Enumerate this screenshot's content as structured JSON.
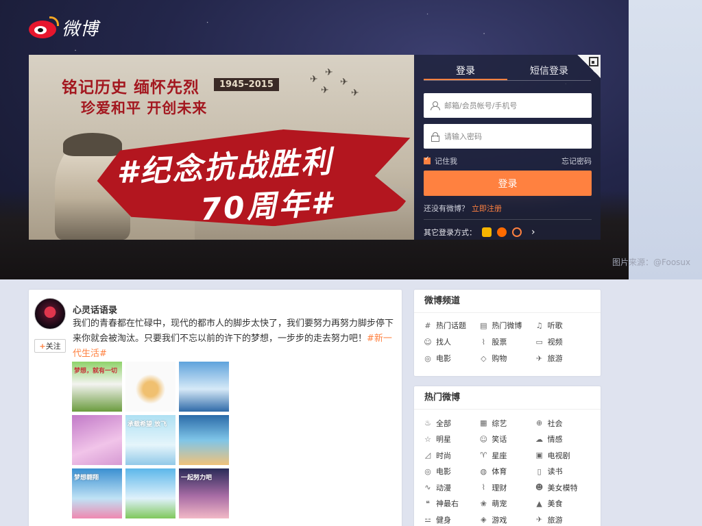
{
  "header": {
    "logo_text": "微博",
    "image_credit": "图片来源：@Foosux"
  },
  "banner": {
    "line1": "铭记历史 缅怀先烈",
    "line2": "珍爱和平 开创未来",
    "years": "1945–2015",
    "slogan1": "#纪念抗战胜利",
    "slogan2": "70周年#"
  },
  "login": {
    "tab_login": "登录",
    "tab_sms": "短信登录",
    "username_placeholder": "邮箱/会员帐号/手机号",
    "password_placeholder": "请输入密码",
    "remember_label": "记住我",
    "forgot_label": "忘记密码",
    "login_button": "登录",
    "no_account_text": "还没有微博？",
    "register_label": "立即注册",
    "other_login_label": "其它登录方式：",
    "third_party": [
      {
        "icon": "qq-icon",
        "color": "#f7b500"
      },
      {
        "icon": "taobao-icon",
        "color": "#ff6a00"
      },
      {
        "icon": "alipay-icon",
        "color": "#ff8140"
      }
    ]
  },
  "feed": {
    "author": "心灵话语录",
    "follow_label": "关注",
    "text": "我们的青春都在忙碌中，现代的都市人的脚步太快了，我们要努力再努力脚步停下来你就会被淘汰。只要我们不忘以前的许下的梦想，一步步的走去努力吧！",
    "hashtag": "#新一代生活#",
    "image_captions": [
      "梦想，就有一切",
      "",
      "",
      "",
      "承载希望 放飞",
      "",
      "梦想翱翔",
      "",
      "一起努力吧"
    ]
  },
  "channels": {
    "title": "微博频道",
    "items": [
      {
        "label": "热门话题",
        "icon": "hash-icon"
      },
      {
        "label": "热门微博",
        "icon": "document-icon"
      },
      {
        "label": "听歌",
        "icon": "music-icon"
      },
      {
        "label": "找人",
        "icon": "user-icon"
      },
      {
        "label": "股票",
        "icon": "chart-icon"
      },
      {
        "label": "视频",
        "icon": "video-icon"
      },
      {
        "label": "电影",
        "icon": "film-icon"
      },
      {
        "label": "购物",
        "icon": "tag-icon"
      },
      {
        "label": "旅游",
        "icon": "plane-icon"
      }
    ]
  },
  "hot": {
    "title": "热门微博",
    "items": [
      {
        "label": "全部",
        "icon": "fire-icon"
      },
      {
        "label": "综艺",
        "icon": "grid-icon"
      },
      {
        "label": "社会",
        "icon": "globe-icon"
      },
      {
        "label": "明星",
        "icon": "star-icon"
      },
      {
        "label": "笑话",
        "icon": "smile-icon"
      },
      {
        "label": "情感",
        "icon": "cloud-icon"
      },
      {
        "label": "时尚",
        "icon": "shoe-icon"
      },
      {
        "label": "星座",
        "icon": "aries-icon"
      },
      {
        "label": "电视剧",
        "icon": "tv-icon"
      },
      {
        "label": "电影",
        "icon": "film-icon"
      },
      {
        "label": "体育",
        "icon": "ball-icon"
      },
      {
        "label": "读书",
        "icon": "book-icon"
      },
      {
        "label": "动漫",
        "icon": "dragon-icon"
      },
      {
        "label": "理财",
        "icon": "chart-icon"
      },
      {
        "label": "美女模特",
        "icon": "face-icon"
      },
      {
        "label": "神最右",
        "icon": "bubble-icon"
      },
      {
        "label": "萌宠",
        "icon": "paw-icon"
      },
      {
        "label": "美食",
        "icon": "cake-icon"
      },
      {
        "label": "健身",
        "icon": "dumbbell-icon"
      },
      {
        "label": "游戏",
        "icon": "gamepad-icon"
      },
      {
        "label": "旅游",
        "icon": "plane-icon"
      }
    ]
  }
}
